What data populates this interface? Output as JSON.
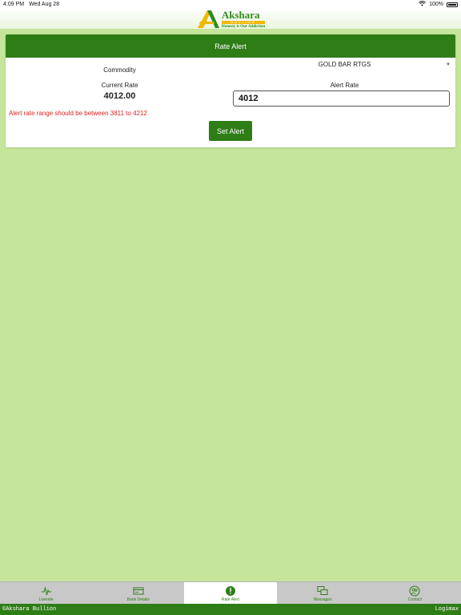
{
  "statusbar": {
    "time": "4:09 PM",
    "date": "Wed Aug 28",
    "battery": "100%"
  },
  "brand": {
    "name": "Akshara",
    "sub": "BULLION",
    "tagline": "Honesty is Our Addiction"
  },
  "rate_alert": {
    "title": "Rate Alert",
    "commodity_label": "Commodity",
    "commodity_value": "GOLD BAR RTGS",
    "current_rate_label": "Current Rate",
    "current_rate_value": "4012.00",
    "alert_rate_label": "Alert Rate",
    "alert_rate_value": "4012",
    "error_text": "Alert rate range should be between 3811 to 4212",
    "set_button": "Set Alert"
  },
  "tabs": [
    {
      "label": "Liverate",
      "icon": "pulse-icon"
    },
    {
      "label": "Bank Details",
      "icon": "card-icon"
    },
    {
      "label": "Rate Alert",
      "icon": "alert-icon",
      "active": true
    },
    {
      "label": "Messages",
      "icon": "messages-icon"
    },
    {
      "label": "Contact",
      "icon": "contact-icon"
    }
  ],
  "footer": {
    "left": "©Akshara Bullion",
    "right": "Logimax"
  },
  "colors": {
    "primary": "#2e7d17",
    "background": "#c5e59b",
    "error": "#e02020"
  }
}
